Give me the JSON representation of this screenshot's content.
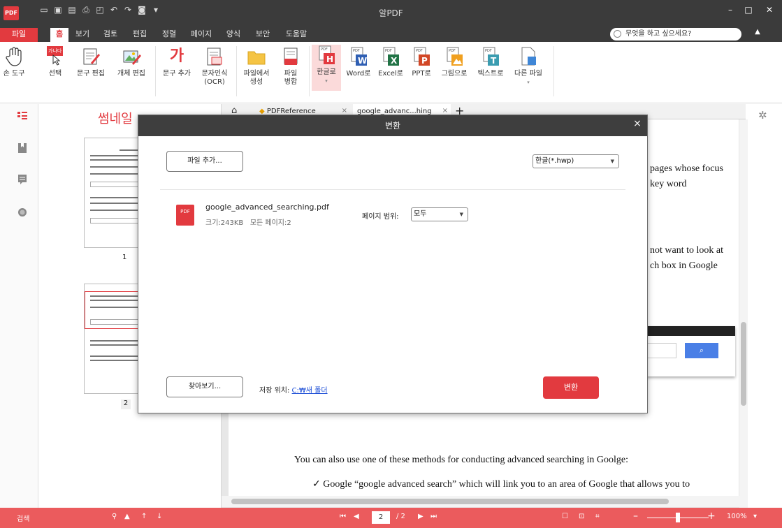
{
  "app": {
    "title": "알PDF",
    "logo": "PDF"
  },
  "quick_access": [
    "folder-open-icon",
    "save-icon",
    "scan-icon",
    "print-icon",
    "preview-icon",
    "undo-icon",
    "redo-icon",
    "settings-icon",
    "dropdown-icon"
  ],
  "window_controls": {
    "minimize": "–",
    "maximize": "□",
    "close": "✕"
  },
  "menu": {
    "tabs": [
      "파일",
      "홈",
      "보기",
      "검토",
      "편집",
      "정렬",
      "페이지",
      "양식",
      "보안",
      "도움말"
    ],
    "active": "홈",
    "search_placeholder": "무엇을 하고 싶으세요?"
  },
  "ribbon": {
    "buttons": [
      {
        "label": "손 도구",
        "icon": "hand-icon"
      },
      {
        "label": "선택",
        "icon": "select-icon",
        "badge": "가나다"
      },
      {
        "label": "문구 편집",
        "icon": "text-edit-icon"
      },
      {
        "label": "개체 편집",
        "icon": "object-edit-icon"
      },
      {
        "label": "문구 추가",
        "icon": "add-text-icon",
        "glyph": "가"
      },
      {
        "label": "문자인식",
        "label2": "(OCR)",
        "icon": "ocr-icon"
      },
      {
        "label": "파일에서",
        "label2": "생성",
        "icon": "folder-icon"
      },
      {
        "label": "파일",
        "label2": "병합",
        "icon": "merge-icon"
      },
      {
        "label": "한글로",
        "icon": "hwp-icon",
        "glyph": "H",
        "color": "#e23a3f",
        "active": true
      },
      {
        "label": "Word로",
        "icon": "word-icon",
        "glyph": "W",
        "color": "#2f5fb3"
      },
      {
        "label": "Excel로",
        "icon": "excel-icon",
        "glyph": "X",
        "color": "#217346"
      },
      {
        "label": "PPT로",
        "icon": "ppt-icon",
        "glyph": "P",
        "color": "#d24726"
      },
      {
        "label": "그림으로",
        "icon": "image-icon",
        "glyph": "▲",
        "color": "#f0a020"
      },
      {
        "label": "텍스트로",
        "icon": "text-icon",
        "glyph": "T",
        "color": "#3a9cb0"
      },
      {
        "label": "다른 파일",
        "icon": "other-file-icon"
      }
    ]
  },
  "thumbnails": {
    "title": "썸네일",
    "pages": [
      "1",
      "2"
    ]
  },
  "doc_tabs": [
    {
      "label": "PDFReference",
      "close": "×"
    },
    {
      "label": "google_advanc...hing",
      "close": "×",
      "active": true
    }
  ],
  "new_tab": "+",
  "document": {
    "lines": [
      "pages whose focus",
      "key word",
      "not want to look at",
      "ch box in Google",
      "You can also use one of these methods for conducting advanced searching in Goolge:",
      "✓   Google “google advanced search” which will link you to an area of Google that allows you to"
    ]
  },
  "dialog": {
    "title": "변환",
    "close": "×",
    "add_file": "파일 추가...",
    "format_select": "한글(*.hwp)",
    "file": {
      "name": "google_advanced_searching.pdf",
      "size": "크기:243KB",
      "pages": "모든 페이지:2"
    },
    "page_range_label": "페이지 범위:",
    "page_range_value": "모두",
    "browse": "찾아보기...",
    "save_label": "저장 위치:",
    "save_path": "C:₩새 폴더",
    "convert": "변환"
  },
  "status": {
    "search": "검색",
    "page_current": "2",
    "page_total": "/ 2",
    "zoom": "100%",
    "zoom_level": 0.5
  },
  "colors": {
    "accent": "#e23a3f",
    "status_bar": "#eb5b5d",
    "titlebar": "#3b3b3b"
  }
}
